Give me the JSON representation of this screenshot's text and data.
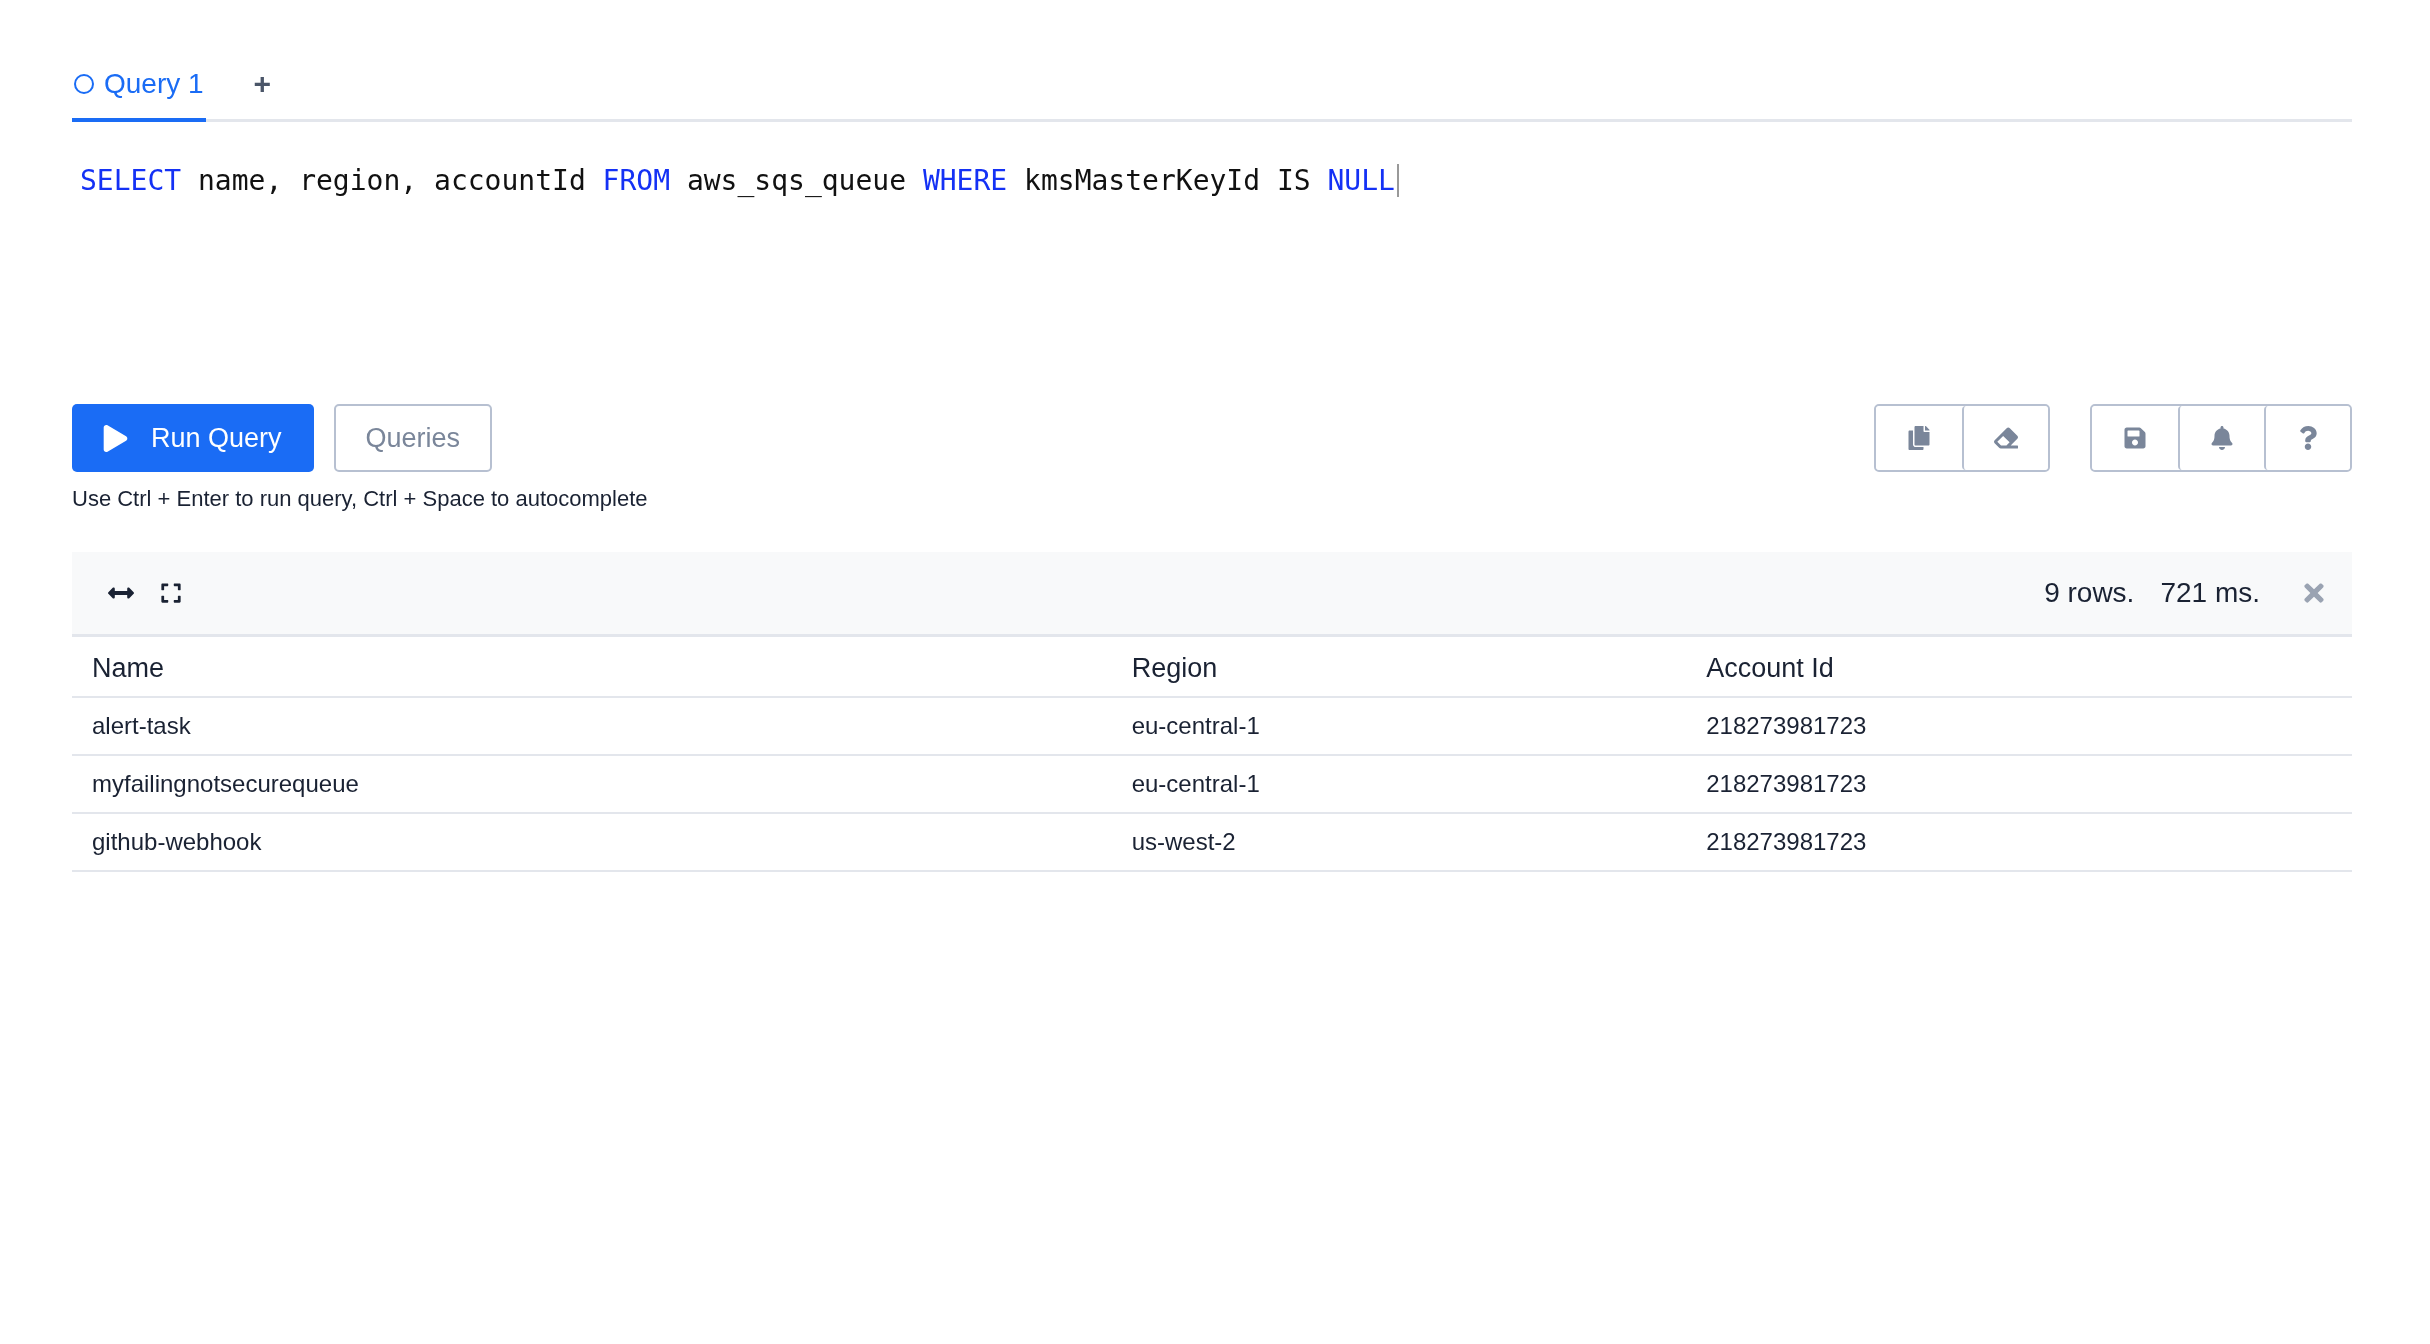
{
  "tabs": [
    {
      "label": "Query 1",
      "selected": true
    }
  ],
  "add_tab": "+",
  "query": [
    {
      "text": "SELECT",
      "kind": "keyword"
    },
    {
      "text": " name, region, accountId ",
      "kind": "plain"
    },
    {
      "text": "FROM",
      "kind": "keyword"
    },
    {
      "text": " aws_sqs_queue ",
      "kind": "plain"
    },
    {
      "text": "WHERE",
      "kind": "keyword"
    },
    {
      "text": " kmsMasterKeyId IS ",
      "kind": "plain"
    },
    {
      "text": "NULL",
      "kind": "keyword"
    }
  ],
  "run_button": "Run Query",
  "queries_button": "Queries",
  "hint": "Use Ctrl + Enter to run query, Ctrl + Space to autocomplete",
  "results": {
    "row_count": "9 rows.",
    "duration": "721 ms.",
    "columns": [
      "Name",
      "Region",
      "Account Id"
    ],
    "rows": [
      [
        "alert-task",
        "eu-central-1",
        "218273981723"
      ],
      [
        "myfailingnotsecurequeue",
        "eu-central-1",
        "218273981723"
      ],
      [
        "github-webhook",
        "us-west-2",
        "218273981723"
      ]
    ]
  }
}
